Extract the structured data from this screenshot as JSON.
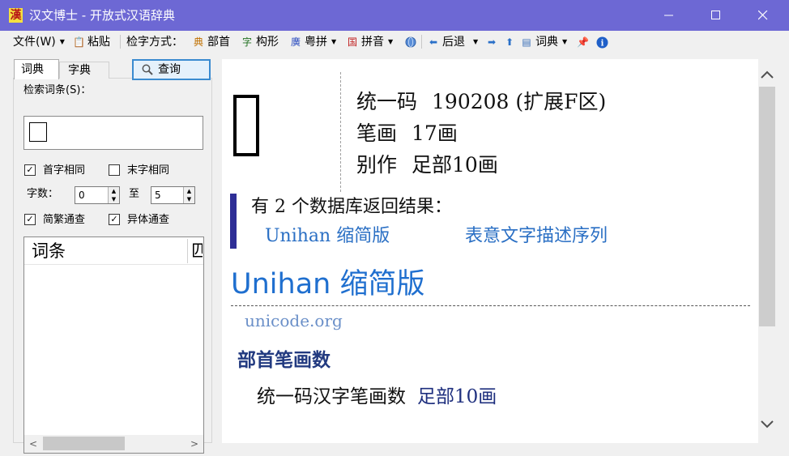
{
  "window": {
    "title": "汉文博士 - 开放式汉语辞典",
    "app_icon_glyph": "漢"
  },
  "toolbar": {
    "file": "文件(W)",
    "paste": "粘贴",
    "method_label": "检字方式：",
    "radical": "部首",
    "structure": "构形",
    "cantonese": "粤拼",
    "pinyin": "拼音",
    "back": "后退",
    "dictionary": "词典",
    "icon_radical": "典",
    "icon_structure": "字",
    "icon_cantonese": "廣",
    "icon_pinyin": "国"
  },
  "left": {
    "tabs": [
      "词典",
      "字典"
    ],
    "query_button": "查询",
    "search_label": "检索词条(S)：",
    "cb_first": "首字相同",
    "cb_first_checked": true,
    "cb_last": "末字相同",
    "cb_last_checked": false,
    "count_label": "字数：",
    "count_from": "0",
    "to_label": "至",
    "count_to": "5",
    "cb_simp": "简繁通查",
    "cb_simp_checked": true,
    "cb_variant": "异体通查",
    "cb_variant_checked": true,
    "list_columns": [
      "词条",
      "匹"
    ]
  },
  "content": {
    "codepoint_key": "统一码",
    "codepoint_value": "190208 (扩展F区)",
    "strokes_key": "笔画",
    "strokes_value": "17画",
    "alt_key": "别作",
    "alt_value": "足部10画",
    "result_heading": "有 2 个数据库返回结果：",
    "db_links": [
      "Unihan 缩简版",
      "表意文字描述序列"
    ],
    "section_title": "Unihan 缩简版",
    "source": "unicode.org",
    "sub_title": "部首笔画数",
    "entry_key": "统一码汉字笔画数",
    "entry_value": "足部10画"
  },
  "colors": {
    "titlebar": "#6d68d4",
    "link": "#2a6fc4",
    "section": "#1f6fcf",
    "accent_bar": "#2e2e96"
  }
}
